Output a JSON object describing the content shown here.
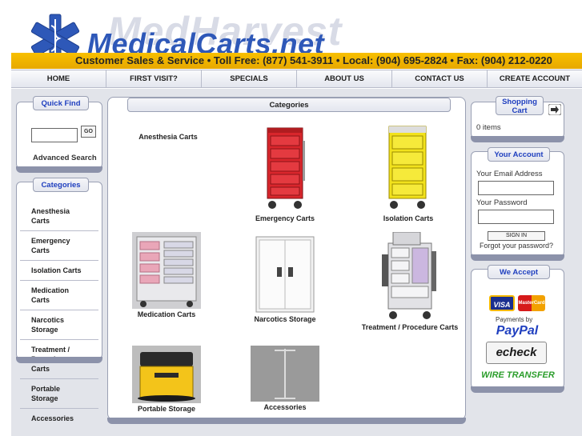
{
  "header": {
    "logo_watermark": "MedHarvest",
    "logo_text": "MedicalCarts.net",
    "ticker": "Customer Sales & Service  •  Toll Free: (877) 541-3911  •  Local: (904) 695-2824  •  Fax: (904) 212-0220"
  },
  "nav": [
    "HOME",
    "FIRST VISIT?",
    "SPECIALS",
    "ABOUT US",
    "CONTACT US",
    "CREATE ACCOUNT"
  ],
  "quick_find": {
    "title": "Quick Find",
    "go_label": "GO",
    "advanced_label": "Advanced Search"
  },
  "categories_sidebar": {
    "title": "Categories",
    "items": [
      "Anesthesia Carts",
      "Emergency Carts",
      "Isolation Carts",
      "Medication Carts",
      "Narcotics Storage",
      "Treatment / Procedure Carts",
      "Portable Storage",
      "Accessories"
    ]
  },
  "main": {
    "title": "Categories",
    "products": [
      {
        "label": "Anesthesia Carts"
      },
      {
        "label": "Emergency Carts",
        "color": "#d9262c"
      },
      {
        "label": "Isolation Carts",
        "color": "#f2e21c"
      },
      {
        "label": "Medication Carts",
        "color": "#e9a6b8"
      },
      {
        "label": "Narcotics Storage",
        "color": "#eeeeee"
      },
      {
        "label": "Treatment / Procedure Carts",
        "color": "#e2e2e6"
      },
      {
        "label": "Portable Storage",
        "color": "#f3c41a"
      },
      {
        "label": "Accessories",
        "color": "#9a9a9a"
      }
    ]
  },
  "cart": {
    "title": "Shopping Cart",
    "items_label": "0 items"
  },
  "account": {
    "title": "Your Account",
    "email_label": "Your Email Address",
    "password_label": "Your Password",
    "signin_label": "SIGN IN",
    "forgot_label": "Forgot your password?"
  },
  "accept": {
    "title": "We Accept",
    "visa": "VISA",
    "mastercard": "MasterCard",
    "paypal_prefix": "Payments by",
    "paypal": "PayPal",
    "echeck": "echeck",
    "wire": "WIRE TRANSFER"
  },
  "colors": {
    "accent_blue": "#1f3fbf",
    "ticker_yellow": "#f4b800"
  }
}
